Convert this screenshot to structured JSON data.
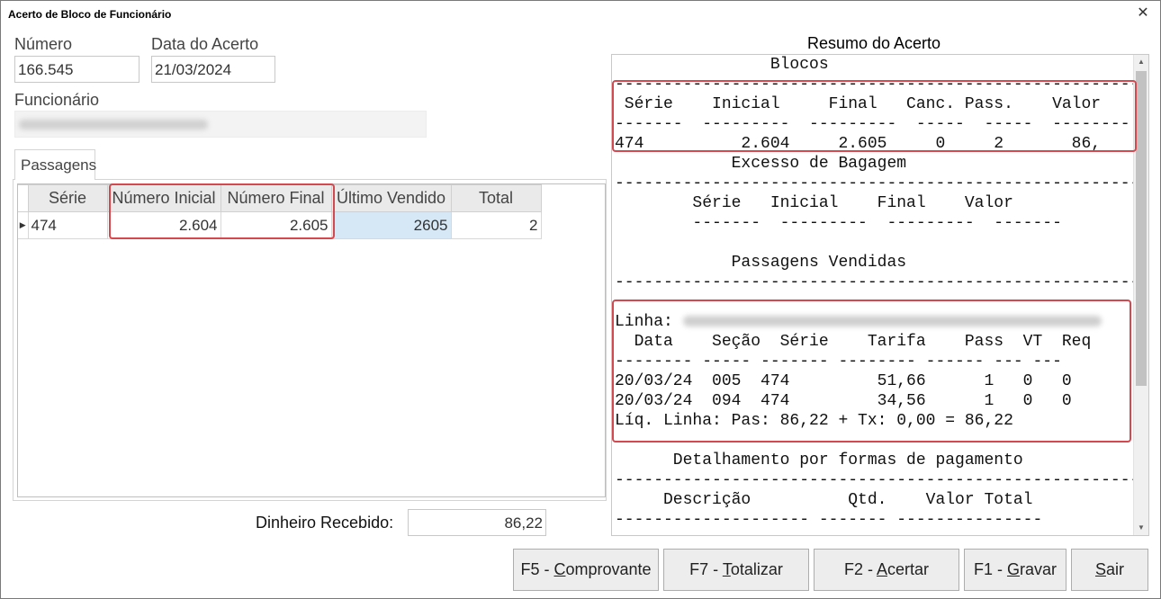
{
  "window": {
    "title": "Acerto de Bloco de Funcionário",
    "close_glyph": "✕"
  },
  "form": {
    "numero_label": "Número",
    "numero_value": "166.545",
    "data_label": "Data do Acerto",
    "data_value": "21/03/2024",
    "funcionario_label": "Funcionário"
  },
  "tabs": [
    {
      "label": "Passagens"
    }
  ],
  "grid": {
    "columns": [
      "Série",
      "Número Inicial",
      "Número Final",
      "Último Vendido",
      "Total"
    ],
    "rows": [
      {
        "indicator": "▶",
        "serie": "474",
        "numero_inicial": "2.604",
        "numero_final": "2.605",
        "ultimo_vendido": "2605",
        "total": "2"
      }
    ]
  },
  "dinheiro": {
    "label": "Dinheiro Recebido:",
    "value": "86,22"
  },
  "summary": {
    "title": "Resumo do Acerto",
    "lines": [
      "                Blocos",
      "-------------------------------------------------------",
      " Série    Inicial     Final   Canc. Pass.    Valor",
      "-------  ---------  ---------  -----  -----  --------",
      "474          2.604     2.605     0     2       86,",
      "            Excesso de Bagagem",
      "-------------------------------------------------------",
      "        Série   Inicial    Final    Valor",
      "        -------  ---------  ---------  -------",
      "",
      "            Passagens Vendidas",
      "-------------------------------------------------------",
      "",
      "Linha: ",
      "  Data    Seção  Série    Tarifa    Pass  VT  Req",
      "-------- ----- ------- -------- ------ --- ---",
      "20/03/24  005  474         51,66      1   0   0",
      "20/03/24  094  474         34,56      1   0   0",
      "Líq. Linha: Pas: 86,22 + Tx: 0,00 = 86,22",
      "",
      "      Detalhamento por formas de pagamento",
      "-------------------------------------------------------",
      "     Descrição          Qtd.    Valor Total",
      "-------------------- ------- ---------------"
    ]
  },
  "buttons": [
    {
      "pre": "F5 - ",
      "key": "C",
      "post": "omprovante"
    },
    {
      "pre": "F7 - ",
      "key": "T",
      "post": "otalizar"
    },
    {
      "pre": "F2 - ",
      "key": "A",
      "post": "certar"
    },
    {
      "pre": "F1 - ",
      "key": "G",
      "post": "ravar"
    },
    {
      "pre": "",
      "key": "S",
      "post": "air"
    }
  ],
  "icons": {
    "scroll_up": "scroll-up-icon",
    "scroll_down": "scroll-down-icon",
    "close": "close-icon"
  },
  "colors": {
    "highlight_border": "#d4494f",
    "selected_cell": "#d6e8f5"
  }
}
